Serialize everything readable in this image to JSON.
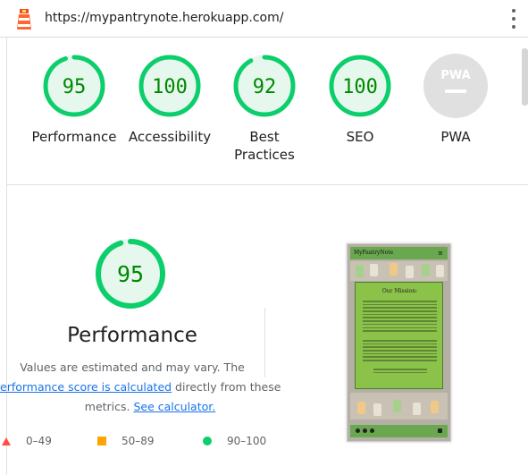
{
  "header": {
    "url": "https://mypantrynote.herokuapp.com/"
  },
  "colors": {
    "pass": "#0cce6b",
    "pass_text": "#008800",
    "pass_fill": "#e6f8ee",
    "average": "#ffa400",
    "fail": "#ff4e42",
    "na": "#9e9e9e"
  },
  "categories": [
    {
      "name": "Performance",
      "score": 95
    },
    {
      "name": "Accessibility",
      "score": 100
    },
    {
      "name": "Best Practices",
      "score": 92
    },
    {
      "name": "SEO",
      "score": 100
    },
    {
      "name": "PWA",
      "score": null,
      "badge_text": "PWA"
    }
  ],
  "performance": {
    "score": 95,
    "title": "Performance",
    "desc_line1": "Values are estimated and may vary. The",
    "desc_link1": "erformance score is calculated",
    "desc_mid": " directly from these",
    "desc_line3": "metrics. ",
    "desc_link2": "See calculator."
  },
  "legend": [
    {
      "range": "0–49",
      "icon": "triangle-icon"
    },
    {
      "range": "50–89",
      "icon": "square-icon"
    },
    {
      "range": "90–100",
      "icon": "circle-icon"
    }
  ],
  "thumbnail": {
    "brand": "MyPantryNote",
    "panel_title": "Our Mission:"
  }
}
